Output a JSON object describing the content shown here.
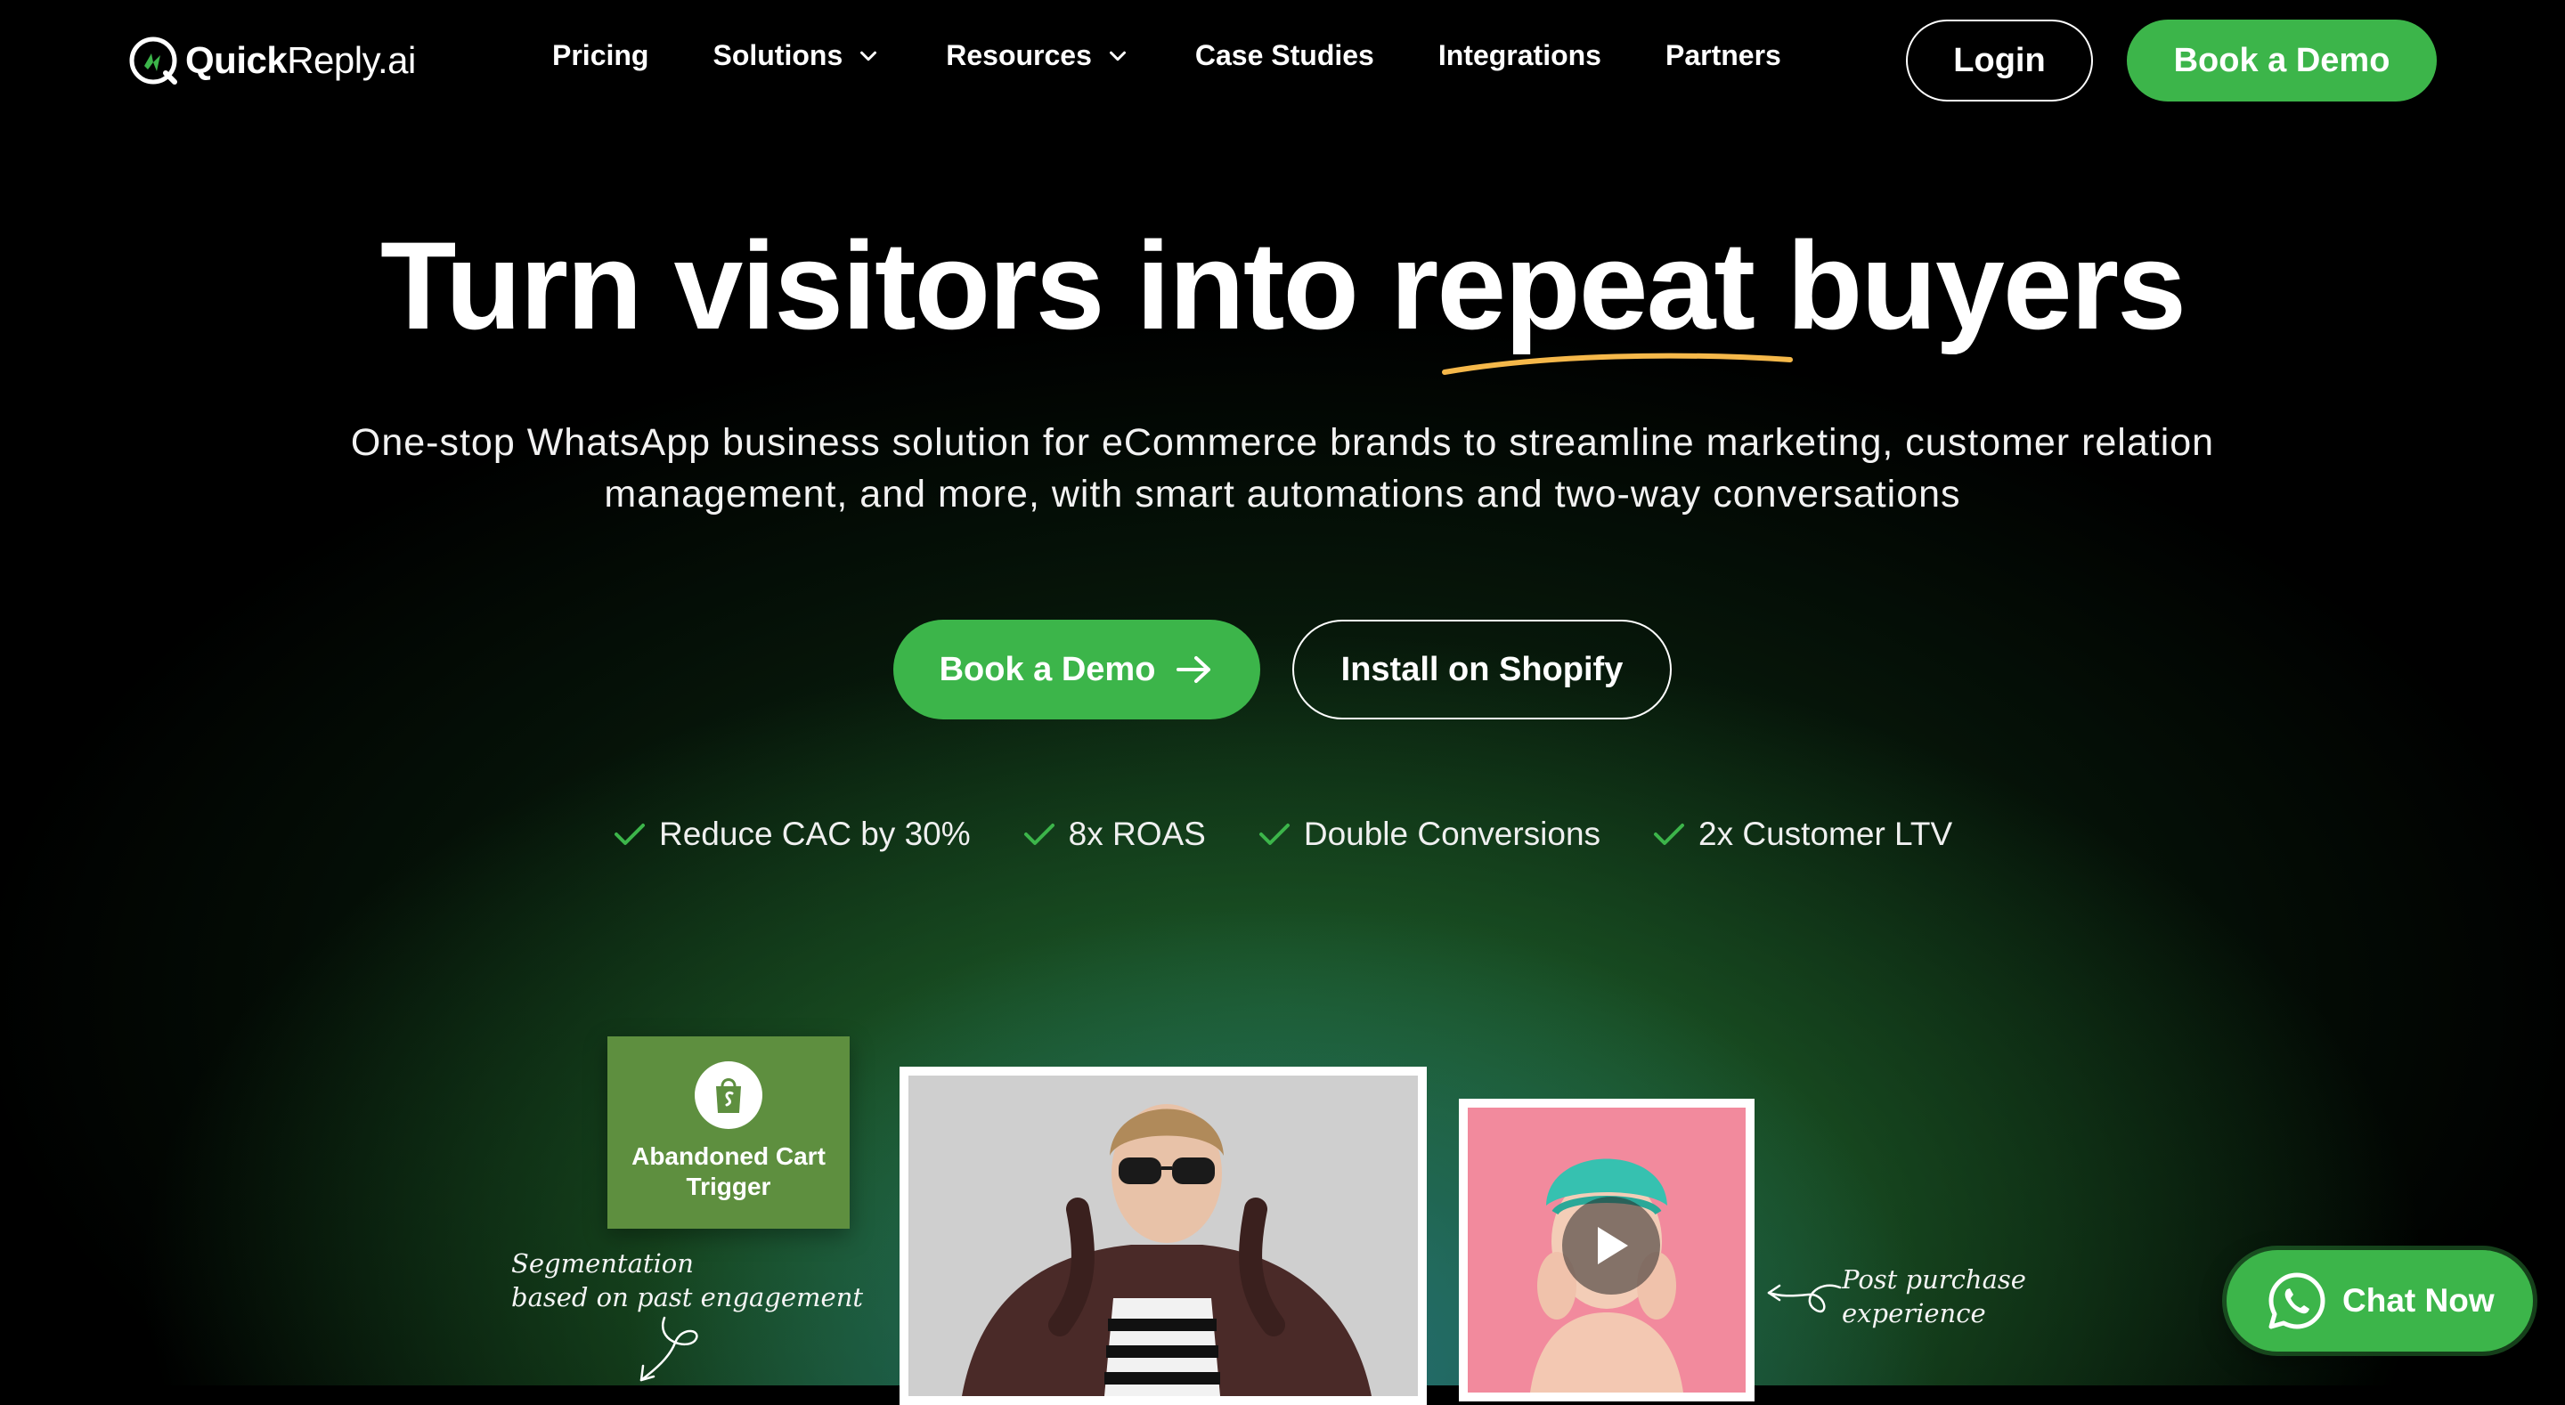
{
  "brand": {
    "name_bold": "Quick",
    "name_light": "Reply.ai",
    "primary_color": "#3cb54a",
    "accent_underline_color": "#f5b84a"
  },
  "nav": {
    "links": [
      {
        "label": "Pricing",
        "has_dropdown": false
      },
      {
        "label": "Solutions",
        "has_dropdown": true
      },
      {
        "label": "Resources",
        "has_dropdown": true
      },
      {
        "label": "Case Studies",
        "has_dropdown": false
      },
      {
        "label": "Integrations",
        "has_dropdown": false
      },
      {
        "label": "Partners",
        "has_dropdown": false
      }
    ],
    "login_label": "Login",
    "demo_label": "Book a Demo"
  },
  "hero": {
    "headline": "Turn visitors into repeat buyers",
    "subtitle_line1": "One-stop WhatsApp business solution for eCommerce brands to streamline marketing, customer relation",
    "subtitle_line2": "management, and more, with smart automations and two-way conversations",
    "cta_primary": "Book a Demo",
    "cta_secondary": "Install on Shopify",
    "benefits": [
      "Reduce CAC by 30%",
      "8x ROAS",
      "Double Conversions",
      "2x Customer LTV"
    ]
  },
  "showcase": {
    "trigger_card": {
      "icon": "shopify-bag-icon",
      "label_line1": "Abandoned Cart",
      "label_line2": "Trigger"
    },
    "note_left_line1": "Segmentation",
    "note_left_line2": "based on past engagement",
    "note_right_line1": "Post purchase",
    "note_right_line2": "experience"
  },
  "chat_widget": {
    "label": "Chat Now",
    "icon": "whatsapp-icon"
  }
}
